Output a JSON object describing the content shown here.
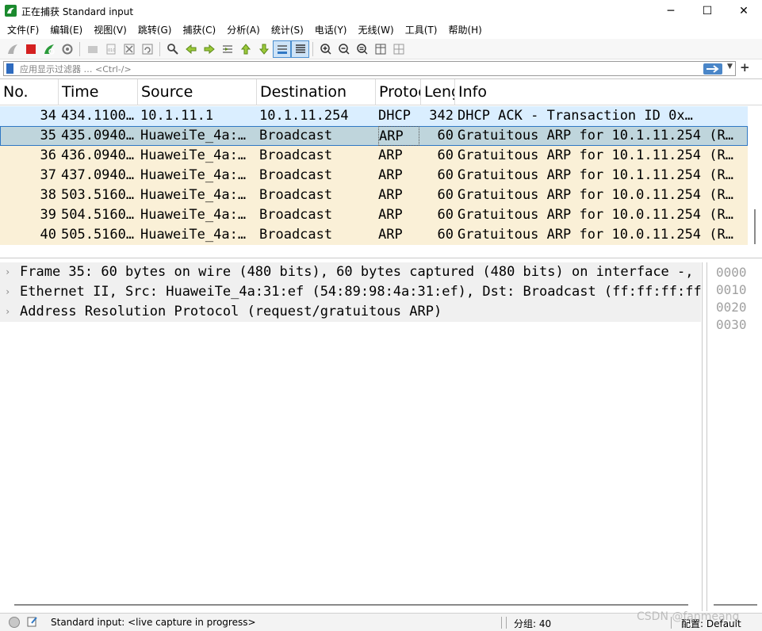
{
  "window": {
    "title": "正在捕获 Standard input",
    "minimize_glyph": "─",
    "maximize_glyph": "☐",
    "close_glyph": "✕"
  },
  "menu": [
    "文件(F)",
    "编辑(E)",
    "视图(V)",
    "跳转(G)",
    "捕获(C)",
    "分析(A)",
    "统计(S)",
    "电话(Y)",
    "无线(W)",
    "工具(T)",
    "帮助(H)"
  ],
  "toolbar": {
    "icons": [
      "shark-fin-start-icon",
      "stop-capture-icon",
      "restart-capture-icon",
      "capture-options-icon",
      "open-file-icon",
      "save-file-icon",
      "close-file-icon",
      "reload-file-icon",
      "find-packet-icon",
      "go-back-icon",
      "go-forward-icon",
      "go-to-packet-icon",
      "go-first-icon",
      "go-last-icon",
      "auto-scroll-icon",
      "colorize-icon",
      "zoom-in-icon",
      "zoom-out-icon",
      "zoom-normal-icon",
      "resize-columns-icon",
      "layout-icon"
    ]
  },
  "filter": {
    "placeholder": "应用显示过滤器 … <Ctrl-/>",
    "value": ""
  },
  "packet_list": {
    "columns": [
      "No.",
      "Time",
      "Source",
      "Destination",
      "Protocol",
      "Length",
      "Info"
    ],
    "rows": [
      {
        "no": "34",
        "time": "434.1100…",
        "source": "10.1.11.1",
        "destination": "10.1.11.254",
        "protocol": "DHCP",
        "length": "342",
        "info": "DHCP ACK      - Transaction ID 0x…",
        "color": "#daeeff"
      },
      {
        "no": "35",
        "time": "435.0940…",
        "source": "HuaweiTe_4a:…",
        "destination": "Broadcast",
        "protocol": "ARP",
        "length": "60",
        "info": "Gratuitous ARP for 10.1.11.254 (R…",
        "color": "#bfd5dc"
      },
      {
        "no": "36",
        "time": "436.0940…",
        "source": "HuaweiTe_4a:…",
        "destination": "Broadcast",
        "protocol": "ARP",
        "length": "60",
        "info": "Gratuitous ARP for 10.1.11.254 (R…",
        "color": "#faf0d7"
      },
      {
        "no": "37",
        "time": "437.0940…",
        "source": "HuaweiTe_4a:…",
        "destination": "Broadcast",
        "protocol": "ARP",
        "length": "60",
        "info": "Gratuitous ARP for 10.1.11.254 (R…",
        "color": "#faf0d7"
      },
      {
        "no": "38",
        "time": "503.5160…",
        "source": "HuaweiTe_4a:…",
        "destination": "Broadcast",
        "protocol": "ARP",
        "length": "60",
        "info": "Gratuitous ARP for 10.0.11.254 (R…",
        "color": "#faf0d7"
      },
      {
        "no": "39",
        "time": "504.5160…",
        "source": "HuaweiTe_4a:…",
        "destination": "Broadcast",
        "protocol": "ARP",
        "length": "60",
        "info": "Gratuitous ARP for 10.0.11.254 (R…",
        "color": "#faf0d7"
      },
      {
        "no": "40",
        "time": "505.5160…",
        "source": "HuaweiTe_4a:…",
        "destination": "Broadcast",
        "protocol": "ARP",
        "length": "60",
        "info": "Gratuitous ARP for 10.0.11.254 (R…",
        "color": "#faf0d7"
      }
    ],
    "selected_no": "35"
  },
  "details": [
    "Frame 35: 60 bytes on wire (480 bits), 60 bytes captured (480 bits) on interface -,",
    "Ethernet II, Src: HuaweiTe_4a:31:ef (54:89:98:4a:31:ef), Dst: Broadcast (ff:ff:ff:ff",
    "Address Resolution Protocol (request/gratuitous ARP)"
  ],
  "bytes_offsets": [
    "0000",
    "0010",
    "0020",
    "0030"
  ],
  "status": {
    "capture_text": "Standard input: <live capture in progress>",
    "packets_text": "分组: 40",
    "profile_text": "配置: Default"
  },
  "watermark": "CSDN @fanmeang"
}
